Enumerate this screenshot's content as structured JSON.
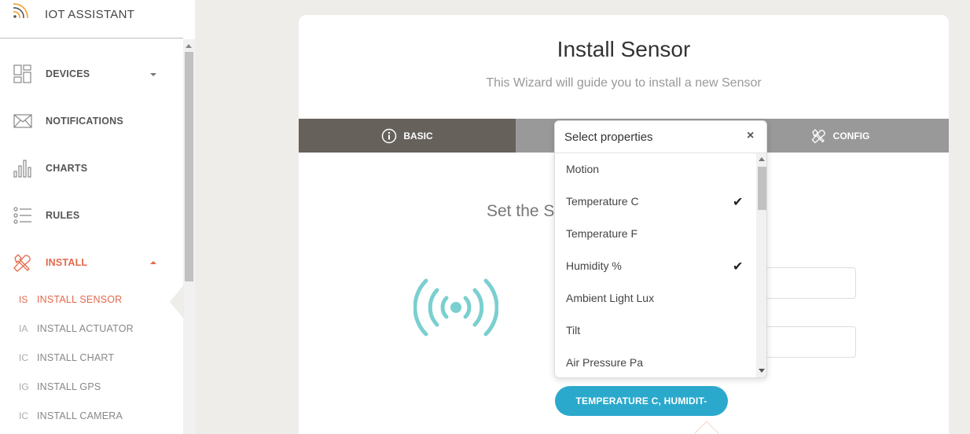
{
  "app": {
    "title": "IOT ASSISTANT"
  },
  "sidebar": {
    "items": [
      {
        "label": "DEVICES",
        "icon": "dashboard-icon"
      },
      {
        "label": "NOTIFICATIONS",
        "icon": "envelope-icon"
      },
      {
        "label": "CHARTS",
        "icon": "bar-chart-icon"
      },
      {
        "label": "RULES",
        "icon": "list-icon"
      },
      {
        "label": "INSTALL",
        "icon": "tools-icon"
      }
    ],
    "subitems": [
      {
        "abbr": "IS",
        "label": "INSTALL SENSOR"
      },
      {
        "abbr": "IA",
        "label": "INSTALL ACTUATOR"
      },
      {
        "abbr": "IC",
        "label": "INSTALL CHART"
      },
      {
        "abbr": "IG",
        "label": "INSTALL GPS"
      },
      {
        "abbr": "IC",
        "label": "INSTALL CAMERA"
      }
    ]
  },
  "wizard": {
    "title": "Install Sensor",
    "subtitle": "This Wizard will guide you to install a new Sensor",
    "tabs": [
      {
        "label": "BASIC",
        "icon": "info-icon"
      },
      {
        "label": "CONFIG",
        "icon": "tools-icon"
      }
    ],
    "step_text": "Set the S",
    "select_button_label": "TEMPERATURE C, HUMIDIT-"
  },
  "dropdown": {
    "title": "Select properties",
    "close": "×",
    "options": [
      {
        "label": "Motion",
        "checked": false
      },
      {
        "label": "Temperature C",
        "checked": true,
        "mark": "✔"
      },
      {
        "label": "Temperature F",
        "checked": false
      },
      {
        "label": "Humidity %",
        "checked": true,
        "mark": "✔"
      },
      {
        "label": "Ambient Light Lux",
        "checked": false
      },
      {
        "label": "Tilt",
        "checked": false
      },
      {
        "label": "Air Pressure Pa",
        "checked": false
      }
    ]
  },
  "colors": {
    "accent": "#e3694c",
    "primary_button": "#2ba9cd",
    "sensor_icon": "#7acfd0",
    "active_tab": "#66615b",
    "tab_bar": "#999999"
  }
}
